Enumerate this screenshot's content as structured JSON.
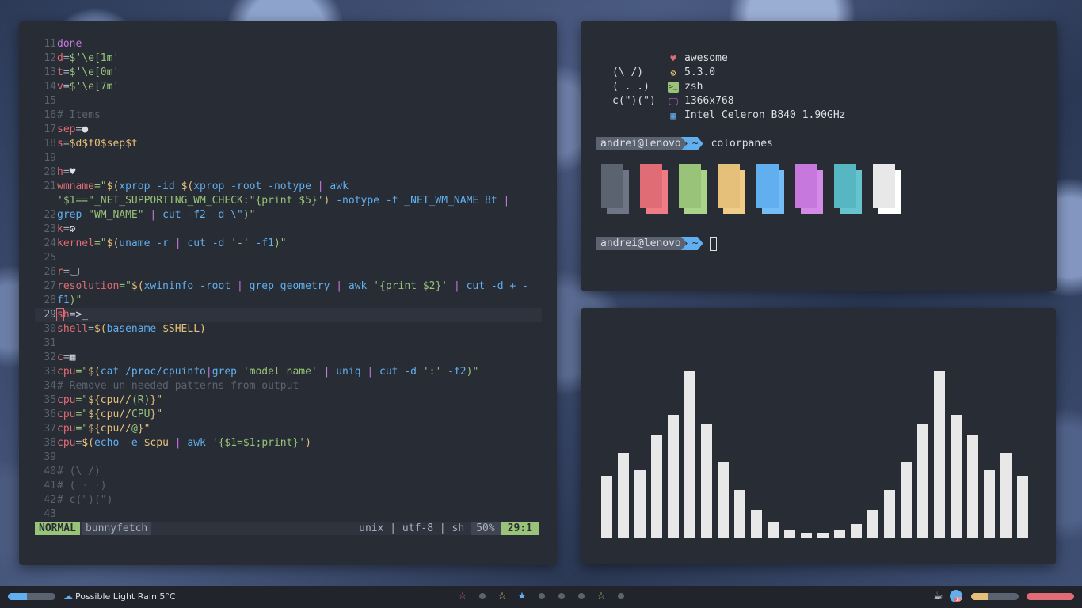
{
  "editor": {
    "lines": [
      {
        "n": "11",
        "segs": [
          [
            "done",
            "c-mag"
          ]
        ]
      },
      {
        "n": "12",
        "segs": [
          [
            "d",
            "c-red"
          ],
          [
            "=",
            "c-fg"
          ],
          [
            "$'\\e[1m'",
            "c-grn"
          ]
        ]
      },
      {
        "n": "13",
        "segs": [
          [
            "t",
            "c-red"
          ],
          [
            "=",
            "c-fg"
          ],
          [
            "$'\\e[0m'",
            "c-grn"
          ]
        ]
      },
      {
        "n": "14",
        "segs": [
          [
            "v",
            "c-red"
          ],
          [
            "=",
            "c-fg"
          ],
          [
            "$'\\e[7m'",
            "c-grn"
          ]
        ]
      },
      {
        "n": "15",
        "segs": []
      },
      {
        "n": "16",
        "segs": [
          [
            "# Items",
            "c-com"
          ]
        ]
      },
      {
        "n": "17",
        "segs": [
          [
            "sep",
            "c-red"
          ],
          [
            "=",
            "c-fg"
          ],
          [
            "●",
            "c-wht"
          ]
        ]
      },
      {
        "n": "18",
        "segs": [
          [
            "s",
            "c-red"
          ],
          [
            "=",
            "c-fg"
          ],
          [
            "$d$f0$sep$t",
            "c-yel"
          ]
        ]
      },
      {
        "n": "19",
        "segs": []
      },
      {
        "n": "20",
        "segs": [
          [
            "h",
            "c-red"
          ],
          [
            "=",
            "c-fg"
          ],
          [
            "♥",
            "c-wht"
          ]
        ]
      },
      {
        "n": "21",
        "wrap": true,
        "segs": [
          [
            "wmname",
            "c-red"
          ],
          [
            "=\"",
            "c-grn"
          ],
          [
            "$(",
            "c-yel"
          ],
          [
            "xprop -id ",
            "c-blu"
          ],
          [
            "$(",
            "c-yel"
          ],
          [
            "xprop -root -notype ",
            "c-blu"
          ],
          [
            "| ",
            "c-mag"
          ],
          [
            "awk ",
            "c-blu"
          ],
          [
            "'$1==\"_NET_SUPPORTING_WM_CHECK:\"{print $5}'",
            "c-grn"
          ],
          [
            ") ",
            "c-yel"
          ],
          [
            "-notype -f _NET_WM_NAME 8t ",
            "c-blu"
          ],
          [
            "| ",
            "c-mag"
          ],
          [
            "grep ",
            "c-blu"
          ],
          [
            "\"WM_NAME\" ",
            "c-grn"
          ],
          [
            "| ",
            "c-mag"
          ],
          [
            "cut -f2 -d \\\"",
            "c-blu"
          ],
          [
            ")\"",
            "c-grn"
          ]
        ]
      },
      {
        "n": "22",
        "segs": []
      },
      {
        "n": "23",
        "segs": [
          [
            "k",
            "c-red"
          ],
          [
            "=",
            "c-fg"
          ],
          [
            "⚙",
            "c-wht"
          ]
        ]
      },
      {
        "n": "24",
        "segs": [
          [
            "kernel",
            "c-red"
          ],
          [
            "=\"",
            "c-grn"
          ],
          [
            "$(",
            "c-yel"
          ],
          [
            "uname -r ",
            "c-blu"
          ],
          [
            "| ",
            "c-mag"
          ],
          [
            "cut -d ",
            "c-blu"
          ],
          [
            "'-' ",
            "c-grn"
          ],
          [
            "-f1",
            "c-blu"
          ],
          [
            ")\"",
            "c-grn"
          ]
        ]
      },
      {
        "n": "25",
        "segs": []
      },
      {
        "n": "26",
        "segs": [
          [
            "r",
            "c-red"
          ],
          [
            "=",
            "c-fg"
          ],
          [
            "🖵",
            "c-wht"
          ]
        ]
      },
      {
        "n": "27",
        "segs": [
          [
            "resolution",
            "c-red"
          ],
          [
            "=\"",
            "c-grn"
          ],
          [
            "$(",
            "c-yel"
          ],
          [
            "xwininfo -root ",
            "c-blu"
          ],
          [
            "| ",
            "c-mag"
          ],
          [
            "grep geometry ",
            "c-blu"
          ],
          [
            "| ",
            "c-mag"
          ],
          [
            "awk ",
            "c-blu"
          ],
          [
            "'{print $2}' ",
            "c-grn"
          ],
          [
            "| ",
            "c-mag"
          ],
          [
            "cut -d + -f1",
            "c-blu"
          ],
          [
            ")\"",
            "c-grn"
          ]
        ]
      },
      {
        "n": "28",
        "segs": []
      },
      {
        "n": "29",
        "cur": true,
        "segs": [
          [
            "s",
            "c-red"
          ],
          [
            "h",
            "c-red"
          ],
          [
            "=",
            "c-fg"
          ],
          [
            ">_",
            "c-wht"
          ]
        ]
      },
      {
        "n": "30",
        "segs": [
          [
            "shell",
            "c-red"
          ],
          [
            "=",
            "c-fg"
          ],
          [
            "$(",
            "c-yel"
          ],
          [
            "basename ",
            "c-blu"
          ],
          [
            "$SHELL",
            "c-yel"
          ],
          [
            ")",
            "c-yel"
          ]
        ]
      },
      {
        "n": "31",
        "segs": []
      },
      {
        "n": "32",
        "segs": [
          [
            "c",
            "c-red"
          ],
          [
            "=",
            "c-fg"
          ],
          [
            "▦",
            "c-wht"
          ]
        ]
      },
      {
        "n": "33",
        "segs": [
          [
            "cpu",
            "c-red"
          ],
          [
            "=\"",
            "c-grn"
          ],
          [
            "$(",
            "c-yel"
          ],
          [
            "cat /proc/cpuinfo",
            "c-blu"
          ],
          [
            "|",
            "c-mag"
          ],
          [
            "grep ",
            "c-blu"
          ],
          [
            "'model name' ",
            "c-grn"
          ],
          [
            "| ",
            "c-mag"
          ],
          [
            "uniq ",
            "c-blu"
          ],
          [
            "| ",
            "c-mag"
          ],
          [
            "cut -d ",
            "c-blu"
          ],
          [
            "':' ",
            "c-grn"
          ],
          [
            "-f2",
            "c-blu"
          ],
          [
            ")\"",
            "c-grn"
          ]
        ]
      },
      {
        "n": "34",
        "segs": [
          [
            "# Remove un-needed patterns from output",
            "c-com"
          ]
        ]
      },
      {
        "n": "35",
        "segs": [
          [
            "cpu",
            "c-red"
          ],
          [
            "=\"",
            "c-grn"
          ],
          [
            "${cpu//",
            "c-yel"
          ],
          [
            "(R)",
            "c-grn"
          ],
          [
            "}\"",
            "c-yel"
          ]
        ]
      },
      {
        "n": "36",
        "segs": [
          [
            "cpu",
            "c-red"
          ],
          [
            "=\"",
            "c-grn"
          ],
          [
            "${cpu//",
            "c-yel"
          ],
          [
            "CPU",
            "c-grn"
          ],
          [
            "}\"",
            "c-yel"
          ]
        ]
      },
      {
        "n": "37",
        "segs": [
          [
            "cpu",
            "c-red"
          ],
          [
            "=\"",
            "c-grn"
          ],
          [
            "${cpu//",
            "c-yel"
          ],
          [
            "@",
            "c-grn"
          ],
          [
            "}\"",
            "c-yel"
          ]
        ]
      },
      {
        "n": "38",
        "segs": [
          [
            "cpu",
            "c-red"
          ],
          [
            "=",
            "c-fg"
          ],
          [
            "$(",
            "c-yel"
          ],
          [
            "echo -e ",
            "c-blu"
          ],
          [
            "$cpu ",
            "c-yel"
          ],
          [
            "| ",
            "c-mag"
          ],
          [
            "awk ",
            "c-blu"
          ],
          [
            "'{$1=$1;print}'",
            "c-grn"
          ],
          [
            ")",
            "c-yel"
          ]
        ]
      },
      {
        "n": "39",
        "segs": []
      },
      {
        "n": "40",
        "segs": [
          [
            "# (\\ /)",
            "c-com"
          ]
        ]
      },
      {
        "n": "41",
        "segs": [
          [
            "# ( · ·)",
            "c-com"
          ]
        ]
      },
      {
        "n": "42",
        "segs": [
          [
            "# c(\")(\")",
            "c-com"
          ]
        ]
      },
      {
        "n": "43",
        "segs": []
      }
    ],
    "status": {
      "mode": "NORMAL",
      "filename": "bunnyfetch",
      "fileformat": "unix | utf-8 | sh",
      "percent": "50%",
      "position": "29:1"
    }
  },
  "fetch": {
    "bunny": [
      "(\\ /)",
      "( . .)",
      "c(\")(\")"
    ],
    "info": [
      {
        "icon": "heart-icon",
        "glyph": "♥",
        "color": "#e06c75",
        "text": "awesome"
      },
      {
        "icon": "gear-icon",
        "glyph": "⚙",
        "color": "#e5c07b",
        "text": "5.3.0"
      },
      {
        "icon": "terminal-icon",
        "glyph": ">_",
        "color": "#98c379",
        "text": "zsh"
      },
      {
        "icon": "monitor-icon",
        "glyph": "🖵",
        "color": "#c678dd",
        "text": "1366x768"
      },
      {
        "icon": "cpu-icon",
        "glyph": "▦",
        "color": "#61afef",
        "text": "Intel Celeron B840 1.90GHz"
      }
    ],
    "prompt1": {
      "user": "andrei@lenovo",
      "dir": "~",
      "cmd": "colorpanes"
    },
    "prompt2": {
      "user": "andrei@lenovo",
      "dir": "~"
    },
    "swatches": [
      {
        "a": "#5c6370",
        "b": "#6e7585"
      },
      {
        "a": "#e06c75",
        "b": "#ef7c85"
      },
      {
        "a": "#98c379",
        "b": "#a9d48a"
      },
      {
        "a": "#e5c07b",
        "b": "#f0cc88"
      },
      {
        "a": "#61afef",
        "b": "#74bdf5"
      },
      {
        "a": "#c678dd",
        "b": "#d48be8"
      },
      {
        "a": "#56b6c2",
        "b": "#66c4cf"
      },
      {
        "a": "#e8e8e8",
        "b": "#ffffff"
      }
    ]
  },
  "visualizer": {
    "levels": [
      78,
      107,
      85,
      130,
      155,
      211,
      143,
      96,
      60,
      35,
      19,
      10,
      6,
      6,
      10,
      17,
      35,
      60,
      96,
      143,
      211,
      155,
      130,
      85,
      107,
      78
    ]
  },
  "bottombar": {
    "volume_level": 0.4,
    "weather": "Possible Light Rain 5°C",
    "tags": [
      {
        "icon": "star-outline-icon",
        "glyph": "☆",
        "color": "#e06c75"
      },
      {
        "icon": "dot-icon",
        "glyph": "",
        "color": "#5c6370"
      },
      {
        "icon": "star-outline-icon",
        "glyph": "☆",
        "color": "#e5c07b"
      },
      {
        "icon": "star-filled-icon",
        "glyph": "★",
        "color": "#61afef"
      },
      {
        "icon": "dot-icon",
        "glyph": "",
        "color": "#5c6370"
      },
      {
        "icon": "dot-icon",
        "glyph": "",
        "color": "#5c6370"
      },
      {
        "icon": "dot-icon",
        "glyph": "",
        "color": "#5c6370"
      },
      {
        "icon": "star-outline-icon",
        "glyph": "☆",
        "color": "#98c379"
      },
      {
        "icon": "dot-icon",
        "glyph": "",
        "color": "#5c6370"
      }
    ],
    "notification_count": "10",
    "battery_level": 0.35,
    "ram_level": 1.0
  }
}
